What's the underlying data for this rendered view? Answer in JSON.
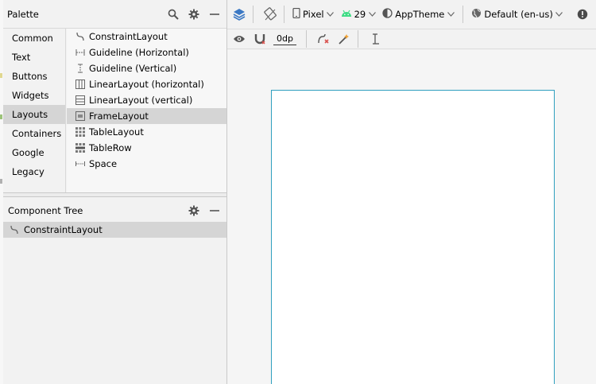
{
  "palette": {
    "title": "Palette",
    "categories": [
      "Common",
      "Text",
      "Buttons",
      "Widgets",
      "Layouts",
      "Containers",
      "Google",
      "Legacy"
    ],
    "selected_category": "Layouts",
    "items": [
      {
        "label": "ConstraintLayout",
        "icon": "constraint-layout-icon"
      },
      {
        "label": "Guideline (Horizontal)",
        "icon": "guideline-horizontal-icon"
      },
      {
        "label": "Guideline (Vertical)",
        "icon": "guideline-vertical-icon"
      },
      {
        "label": "LinearLayout (horizontal)",
        "icon": "linear-layout-horizontal-icon"
      },
      {
        "label": "LinearLayout (vertical)",
        "icon": "linear-layout-vertical-icon"
      },
      {
        "label": "FrameLayout",
        "icon": "frame-layout-icon"
      },
      {
        "label": "TableLayout",
        "icon": "table-layout-icon"
      },
      {
        "label": "TableRow",
        "icon": "table-row-icon"
      },
      {
        "label": "Space",
        "icon": "space-icon"
      }
    ],
    "selected_item": "FrameLayout"
  },
  "component_tree": {
    "title": "Component Tree",
    "root": "ConstraintLayout"
  },
  "toolbar": {
    "device": "Pixel",
    "api_level": "29",
    "theme": "AppTheme",
    "locale": "Default (en-us)",
    "margin": "0dp"
  },
  "colors": {
    "selection": "#d5d5d5",
    "accent_blue": "#3b78c4",
    "android_green": "#3ddc84",
    "device_border": "#2f9fbf",
    "error_red": "#d9534f"
  }
}
